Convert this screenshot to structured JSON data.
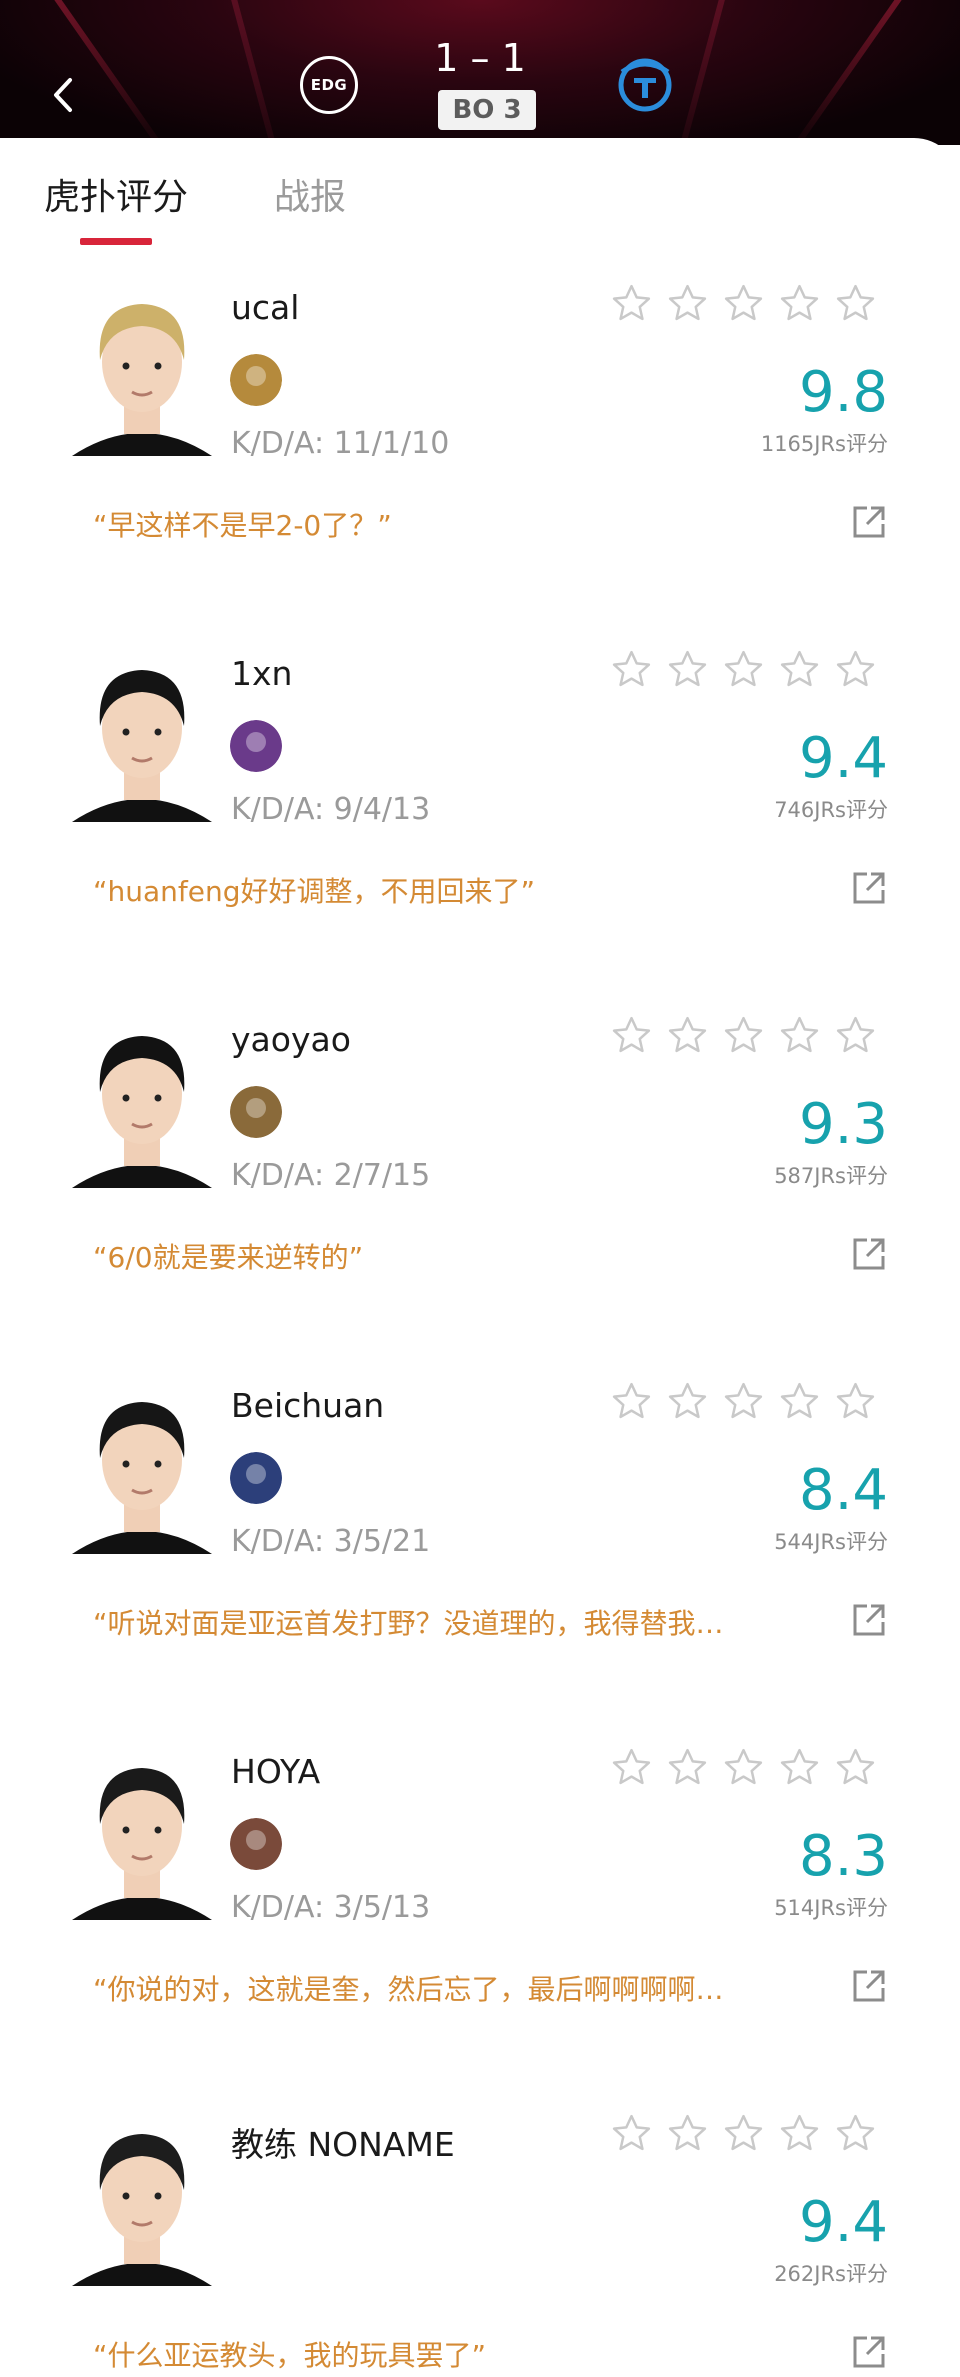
{
  "match": {
    "score": "1 – 1",
    "format": "BO 3",
    "left_team_logo_text": "EDG"
  },
  "tabs": [
    {
      "label": "虎扑评分"
    },
    {
      "label": "战报"
    }
  ],
  "kda_prefix": "K/D/A: ",
  "players": [
    {
      "name": "ucal",
      "kda": "K/D/A: 11/1/10",
      "rating": "9.8",
      "votes": "1165JRs评分",
      "comment": "“早这样不是早2-0了？”",
      "hair": "#cdb16a",
      "champ": "#b58a3c"
    },
    {
      "name": "1xn",
      "kda": "K/D/A: 9/4/13",
      "rating": "9.4",
      "votes": "746JRs评分",
      "comment": "“huanfeng好好调整，不用回来了”",
      "hair": "#141414",
      "champ": "#6a3a8a"
    },
    {
      "name": "yaoyao",
      "kda": "K/D/A: 2/7/15",
      "rating": "9.3",
      "votes": "587JRs评分",
      "comment": "“6/0就是要来逆转的”",
      "hair": "#121212",
      "champ": "#8a6a3a"
    },
    {
      "name": "Beichuan",
      "kda": "K/D/A: 3/5/21",
      "rating": "8.4",
      "votes": "544JRs评分",
      "comment": "“听说对面是亚运首发打野？没道理的，我得替我…",
      "hair": "#161616",
      "champ": "#2c3f7a"
    },
    {
      "name": "HOYA",
      "kda": "K/D/A: 3/5/13",
      "rating": "8.3",
      "votes": "514JRs评分",
      "comment": "“你说的对，这就是奎，然后忘了，最后啊啊啊啊…",
      "hair": "#1a1a1a",
      "champ": "#7a4a3a"
    },
    {
      "name": "教练 NONAME",
      "kda": "",
      "rating": "9.4",
      "votes": "262JRs评分",
      "comment": "“什么亚运教头，我的玩具罢了”",
      "hair": "#1d1d1d",
      "champ": ""
    }
  ],
  "colors": {
    "accent_red": "#d8253a",
    "rating_teal": "#17a2ad",
    "comment_orange": "#d48a34"
  },
  "icons": {
    "back": "chevron-left-icon",
    "star": "star-outline-icon",
    "share": "external-link-icon"
  }
}
